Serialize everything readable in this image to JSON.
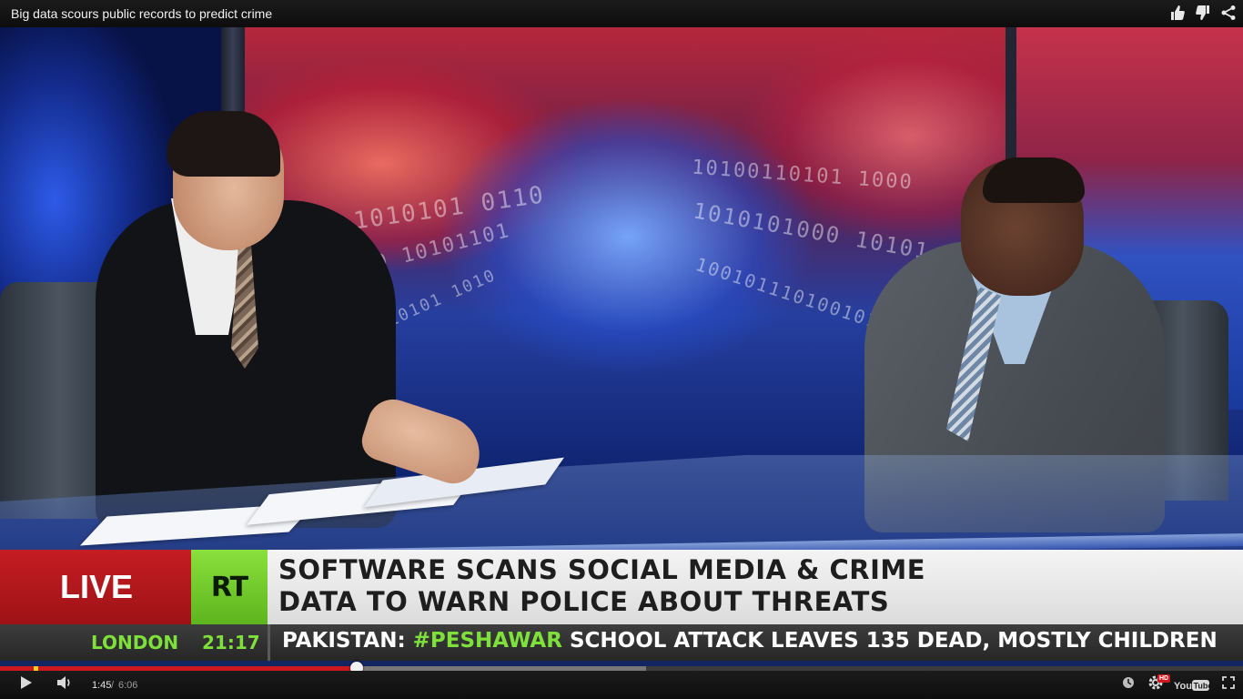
{
  "window": {
    "title": "Big data scours public records to predict crime",
    "icons": [
      "thumbs-up-icon",
      "thumbs-down-icon",
      "share-icon"
    ]
  },
  "broadcast": {
    "live_label": "LIVE",
    "channel_logo": "RT",
    "headline_line1": "SOFTWARE SCANS SOCIAL MEDIA & CRIME",
    "headline_line2": "DATA TO WARN POLICE ABOUT THREATS",
    "location": "LONDON",
    "local_time": "21:17",
    "ticker_prefix": "PAKISTAN: ",
    "ticker_hashtag": "#PESHAWAR",
    "ticker_rest": " SCHOOL ATTACK LEAVES 135 DEAD, MOSTLY CHILDREN",
    "colors": {
      "live_red": "#c51d22",
      "rt_green": "#6cc928",
      "ticker_green": "#7ee03a"
    }
  },
  "player": {
    "current_time": "1:45",
    "separator": "/",
    "duration": "6:06",
    "played_fraction": 0.287,
    "buffered_fraction": 0.52,
    "hd_label": "HD",
    "logo_text": "YouTube",
    "icons": [
      "play-icon",
      "volume-icon",
      "watch-later-icon",
      "settings-icon",
      "youtube-logo",
      "fullscreen-icon"
    ],
    "colors": {
      "progress_played": "#cc181e",
      "progress_ad_marker": "#f2d21c"
    }
  }
}
